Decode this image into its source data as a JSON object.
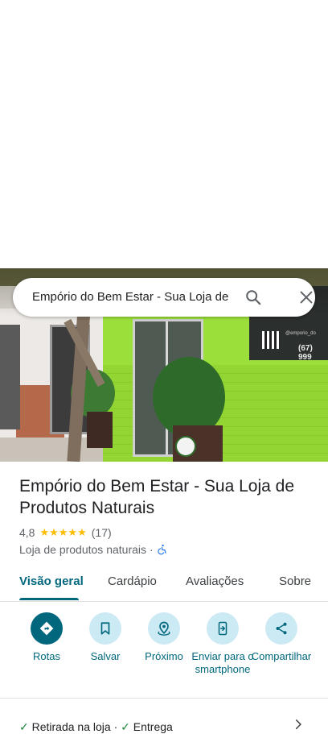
{
  "search": {
    "query": "Empório do Bem Estar - Sua Loja de"
  },
  "place": {
    "name": "Empório do Bem Estar - Sua Loja de Produtos Naturais",
    "rating": "4,8",
    "stars": "★★★★★",
    "review_count": "(17)",
    "category": "Loja de produtos naturais",
    "separator": "·"
  },
  "photo_sign": {
    "phone_fragment": "(67) 999",
    "handle_fragment": "@emporio_do"
  },
  "tabs": [
    {
      "label": "Visão geral",
      "active": true
    },
    {
      "label": "Cardápio",
      "active": false
    },
    {
      "label": "Avaliações",
      "active": false
    },
    {
      "label": "Sobre",
      "active": false
    }
  ],
  "actions": [
    {
      "label": "Rotas",
      "icon": "directions-icon"
    },
    {
      "label": "Salvar",
      "icon": "bookmark-icon"
    },
    {
      "label": "Próximo",
      "icon": "nearby-icon"
    },
    {
      "label": "Enviar para o smartphone",
      "icon": "send-to-phone-icon"
    },
    {
      "label": "Compartilhar",
      "icon": "share-icon"
    }
  ],
  "services": {
    "item1": "Retirada na loja",
    "item2": "Entrega",
    "separator": "·"
  },
  "colors": {
    "accent": "#00677d",
    "accent_light": "#cceaf3",
    "star": "#fbbc04",
    "check": "#188038"
  }
}
